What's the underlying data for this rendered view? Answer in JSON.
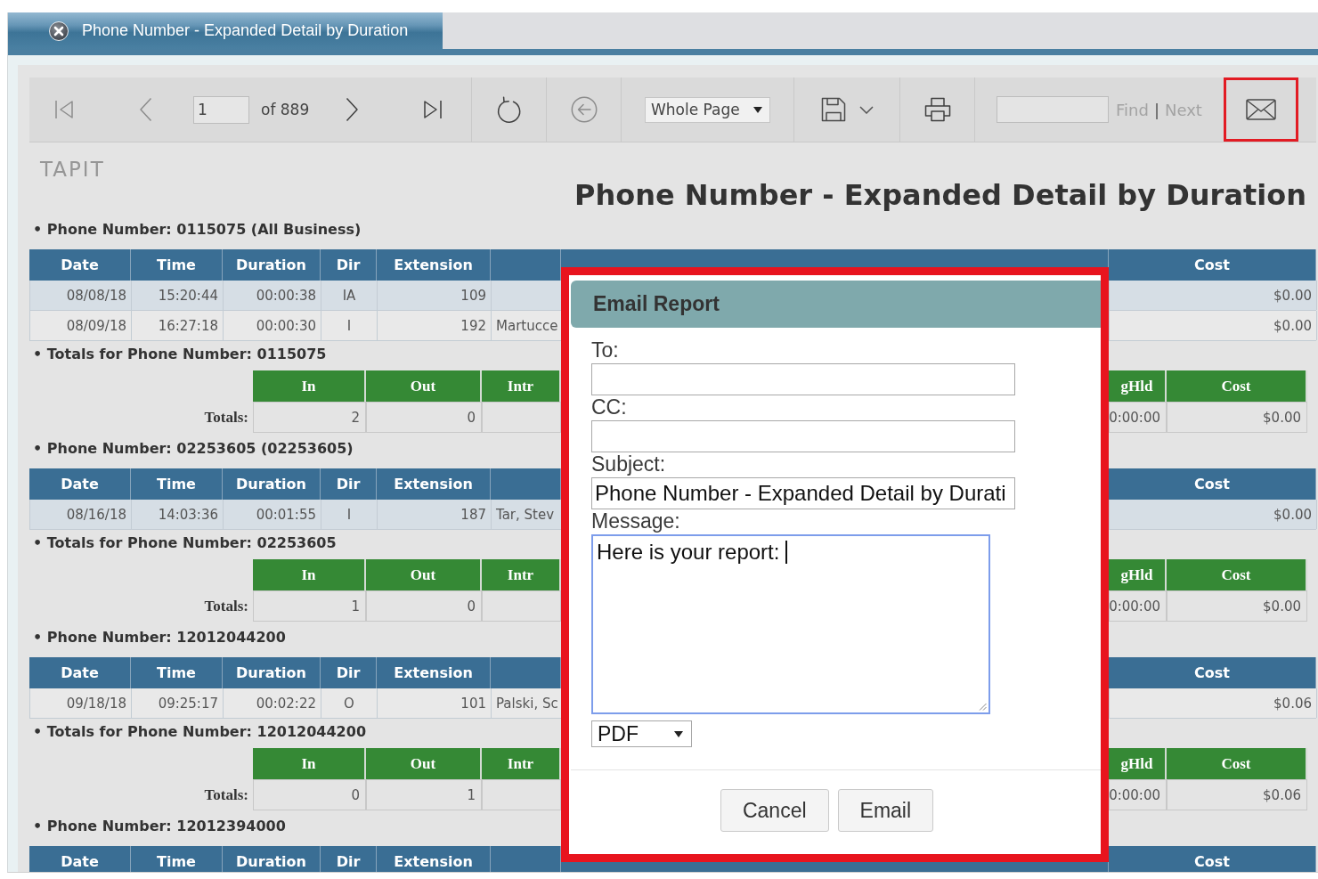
{
  "tab": {
    "title": "Phone Number - Expanded Detail by Duration"
  },
  "toolbar": [
    {
      "kind": "pager",
      "before": [
        {
          "kind": "first",
          "disabled": true
        },
        {
          "kind": "previous",
          "disabled": true
        }
      ],
      "page": "1",
      "page_count": "of 889",
      "after": [
        {
          "kind": "next",
          "disabled": false
        },
        {
          "kind": "last",
          "disabled": false
        }
      ]
    },
    {
      "kind": "refresh",
      "disabled": false
    },
    {
      "kind": "back",
      "disabled": true
    },
    {
      "kind": "select",
      "value": "Whole Page"
    },
    {
      "kind": "save",
      "disabled": false
    },
    {
      "kind": "print",
      "disabled": false
    },
    {
      "kind": "find",
      "links": [
        {
          "label": "Find",
          "disabled": true
        },
        {
          "label": "Next",
          "disabled": true
        }
      ],
      "separator": "|"
    },
    {
      "kind": "email",
      "disabled": false,
      "highlighted": true
    }
  ],
  "report": {
    "logo": "TAPIT",
    "title": "Phone Number - Expanded Detail by Duration",
    "sections": [
      {
        "kind": "detail",
        "heading": "• Phone Number: 0115075 (All Business)",
        "columns": [
          "Date",
          "Time",
          "Duration",
          "Dir",
          "Extension"
        ],
        "last_column": "Cost",
        "rows": [
          {
            "cells": [
              "08/08/18",
              "15:20:44",
              "00:00:38",
              "IA",
              "109"
            ],
            "cost": "$0.00",
            "shaded": true
          },
          {
            "cells": [
              "08/09/18",
              "16:27:18",
              "00:00:30",
              "I",
              "192"
            ],
            "user": "Martucce",
            "cost": "$0.00",
            "shaded": false
          }
        ]
      },
      {
        "kind": "totals",
        "heading": "• Totals for Phone Number: 0115075",
        "label": "Totals:",
        "columns": [
          "In",
          "Out",
          "Intr"
        ],
        "values": [
          "2",
          "0"
        ],
        "right_columns": [
          "gHld",
          "Cost"
        ],
        "right_values": [
          "0:00:00",
          "$0.00"
        ]
      },
      {
        "kind": "detail",
        "heading": "• Phone Number: 02253605 (02253605)",
        "columns": [
          "Date",
          "Time",
          "Duration",
          "Dir",
          "Extension"
        ],
        "last_column": "Cost",
        "rows": [
          {
            "cells": [
              "08/16/18",
              "14:03:36",
              "00:01:55",
              "I",
              "187"
            ],
            "user": "Tar, Stev",
            "cost": "$0.00",
            "shaded": true
          }
        ]
      },
      {
        "kind": "totals",
        "heading": "• Totals for Phone Number: 02253605",
        "label": "Totals:",
        "columns": [
          "In",
          "Out",
          "Intr"
        ],
        "values": [
          "1",
          "0"
        ],
        "right_columns": [
          "gHld",
          "Cost"
        ],
        "right_values": [
          "0:00:00",
          "$0.00"
        ]
      },
      {
        "kind": "detail",
        "heading": "• Phone Number: 12012044200",
        "columns": [
          "Date",
          "Time",
          "Duration",
          "Dir",
          "Extension"
        ],
        "last_column": "Cost",
        "rows": [
          {
            "cells": [
              "09/18/18",
              "09:25:17",
              "00:02:22",
              "O",
              "101"
            ],
            "user": "Palski, Sc",
            "cost": "$0.06",
            "shaded": false
          }
        ]
      },
      {
        "kind": "totals",
        "heading": "• Totals for Phone Number: 12012044200",
        "label": "Totals:",
        "columns": [
          "In",
          "Out",
          "Intr"
        ],
        "values": [
          "0",
          "1"
        ],
        "right_columns": [
          "gHld",
          "Cost"
        ],
        "right_values": [
          "0:00:00",
          "$0.06"
        ]
      },
      {
        "kind": "detail",
        "heading": "• Phone Number: 12012394000",
        "columns": [
          "Date",
          "Time",
          "Duration",
          "Dir",
          "Extension"
        ],
        "last_column": "Cost"
      }
    ]
  },
  "dialog": {
    "title": "Email Report",
    "highlighted": true,
    "fields": [
      {
        "kind": "input",
        "label": "To:"
      },
      {
        "kind": "input",
        "label": "CC:"
      },
      {
        "kind": "input",
        "label": "Subject:",
        "value": "Phone Number - Expanded Detail by Durati"
      },
      {
        "kind": "textarea",
        "label": "Message:",
        "value": "Here is your report: ",
        "focused": true
      }
    ],
    "format": "PDF",
    "buttons": [
      "Cancel",
      "Email"
    ]
  }
}
